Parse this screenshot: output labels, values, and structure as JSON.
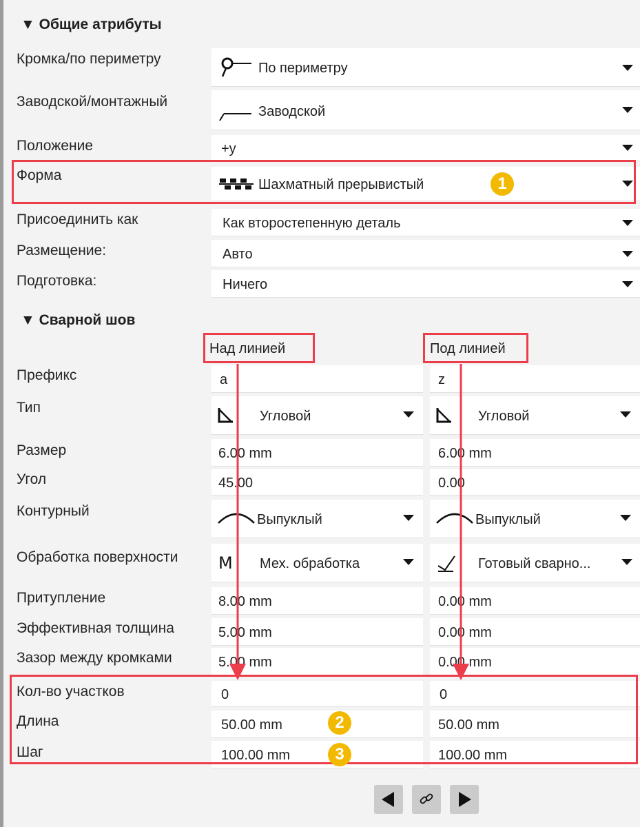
{
  "general_section": {
    "title": "▼ Общие атрибуты",
    "rows": [
      {
        "label": "Кромка/по периметру",
        "value": "По периметру",
        "icon": "perimeter-weld-icon"
      },
      {
        "label": "Заводской/монтажный",
        "value": "Заводской",
        "icon": "shop-weld-icon"
      },
      {
        "label": "Положение",
        "value": "+y"
      },
      {
        "label": "Форма",
        "value": "Шахматный прерывистый",
        "icon": "staggered-intermittent-icon"
      },
      {
        "label": "Присоединить как",
        "value": "Как второстепенную деталь"
      },
      {
        "label": "Размещение:",
        "value": "Авто"
      },
      {
        "label": "Подготовка:",
        "value": "Ничего"
      }
    ]
  },
  "weld_section": {
    "title": "▼ Сварной шов",
    "col_above": "Над линией",
    "col_below": "Под линией",
    "rows": [
      {
        "label": "Префикс",
        "above": "a",
        "below": "z"
      },
      {
        "label": "Тип",
        "above": "Угловой",
        "below": "Угловой",
        "above_icon": "fillet-weld-icon",
        "below_icon": "fillet-weld-icon"
      },
      {
        "label": "Размер",
        "above": "6.00 mm",
        "below": "6.00 mm"
      },
      {
        "label": "Угол",
        "above": "45.00",
        "below": "0.00"
      },
      {
        "label": "Контурный",
        "above": "Выпуклый",
        "below": "Выпуклый",
        "above_icon": "convex-contour-icon",
        "below_icon": "convex-contour-icon"
      },
      {
        "label": "Обработка поверхности",
        "above": "Мех. обработка",
        "below": "Готовый сварно...",
        "above_icon": "machining-finish-icon",
        "below_icon": "as-welded-finish-icon"
      },
      {
        "label": "Притупление",
        "above": "8.00 mm",
        "below": "0.00 mm"
      },
      {
        "label": "Эффективная толщина",
        "above": "5.00 mm",
        "below": "0.00 mm"
      },
      {
        "label": "Зазор между кромками",
        "above": "5.00 mm",
        "below": "0.00 mm"
      },
      {
        "label": "Кол-во участков",
        "above": "0",
        "below": "0"
      },
      {
        "label": "Длина",
        "above": "50.00 mm",
        "below": "50.00 mm"
      },
      {
        "label": "Шаг",
        "above": "100.00 mm",
        "below": "100.00 mm"
      }
    ]
  },
  "badges": [
    "1",
    "2",
    "3"
  ],
  "nav": {
    "prev_icon": "triangle-left-icon",
    "link_icon": "chain-link-icon",
    "next_icon": "triangle-right-icon"
  },
  "colors": {
    "highlight": "#ec3d4b",
    "badge": "#f3b900",
    "panel_bg": "#f3f3f3",
    "field_bg": "#ffffff"
  }
}
